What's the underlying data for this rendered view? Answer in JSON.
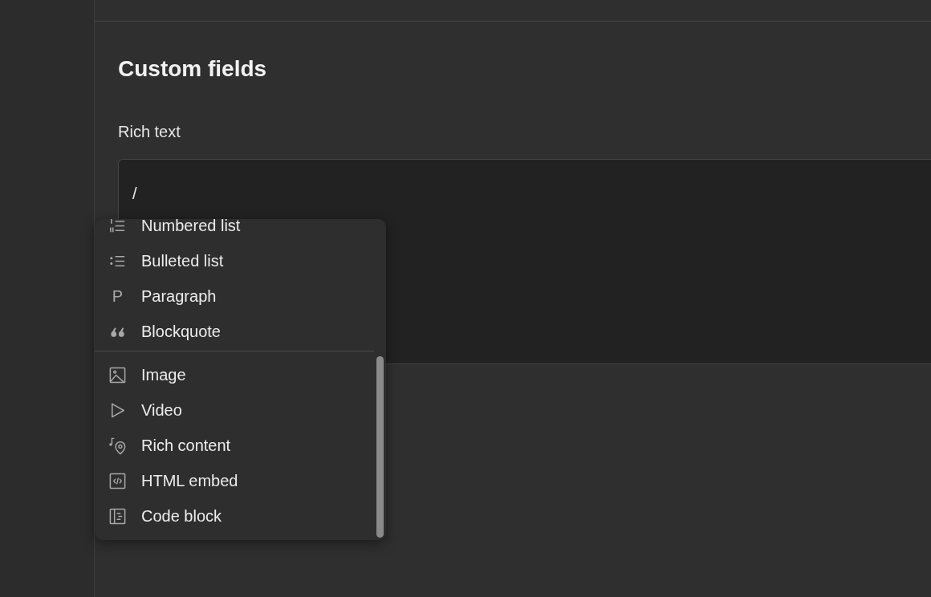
{
  "section": {
    "title": "Custom fields",
    "field": {
      "label": "Rich text",
      "value": "/"
    }
  },
  "block_menu": {
    "groups": [
      {
        "items": [
          {
            "label": "Numbered list",
            "kind": "numbered-list"
          },
          {
            "label": "Bulleted list",
            "kind": "bulleted-list"
          },
          {
            "label": "Paragraph",
            "kind": "glyph",
            "glyph": "P"
          },
          {
            "label": "Blockquote",
            "kind": "blockquote"
          }
        ]
      },
      {
        "items": [
          {
            "label": "Image",
            "kind": "image"
          },
          {
            "label": "Video",
            "kind": "video"
          },
          {
            "label": "Rich content",
            "kind": "rich-content"
          },
          {
            "label": "HTML embed",
            "kind": "html-embed"
          },
          {
            "label": "Code block",
            "kind": "code-block"
          }
        ]
      }
    ]
  }
}
